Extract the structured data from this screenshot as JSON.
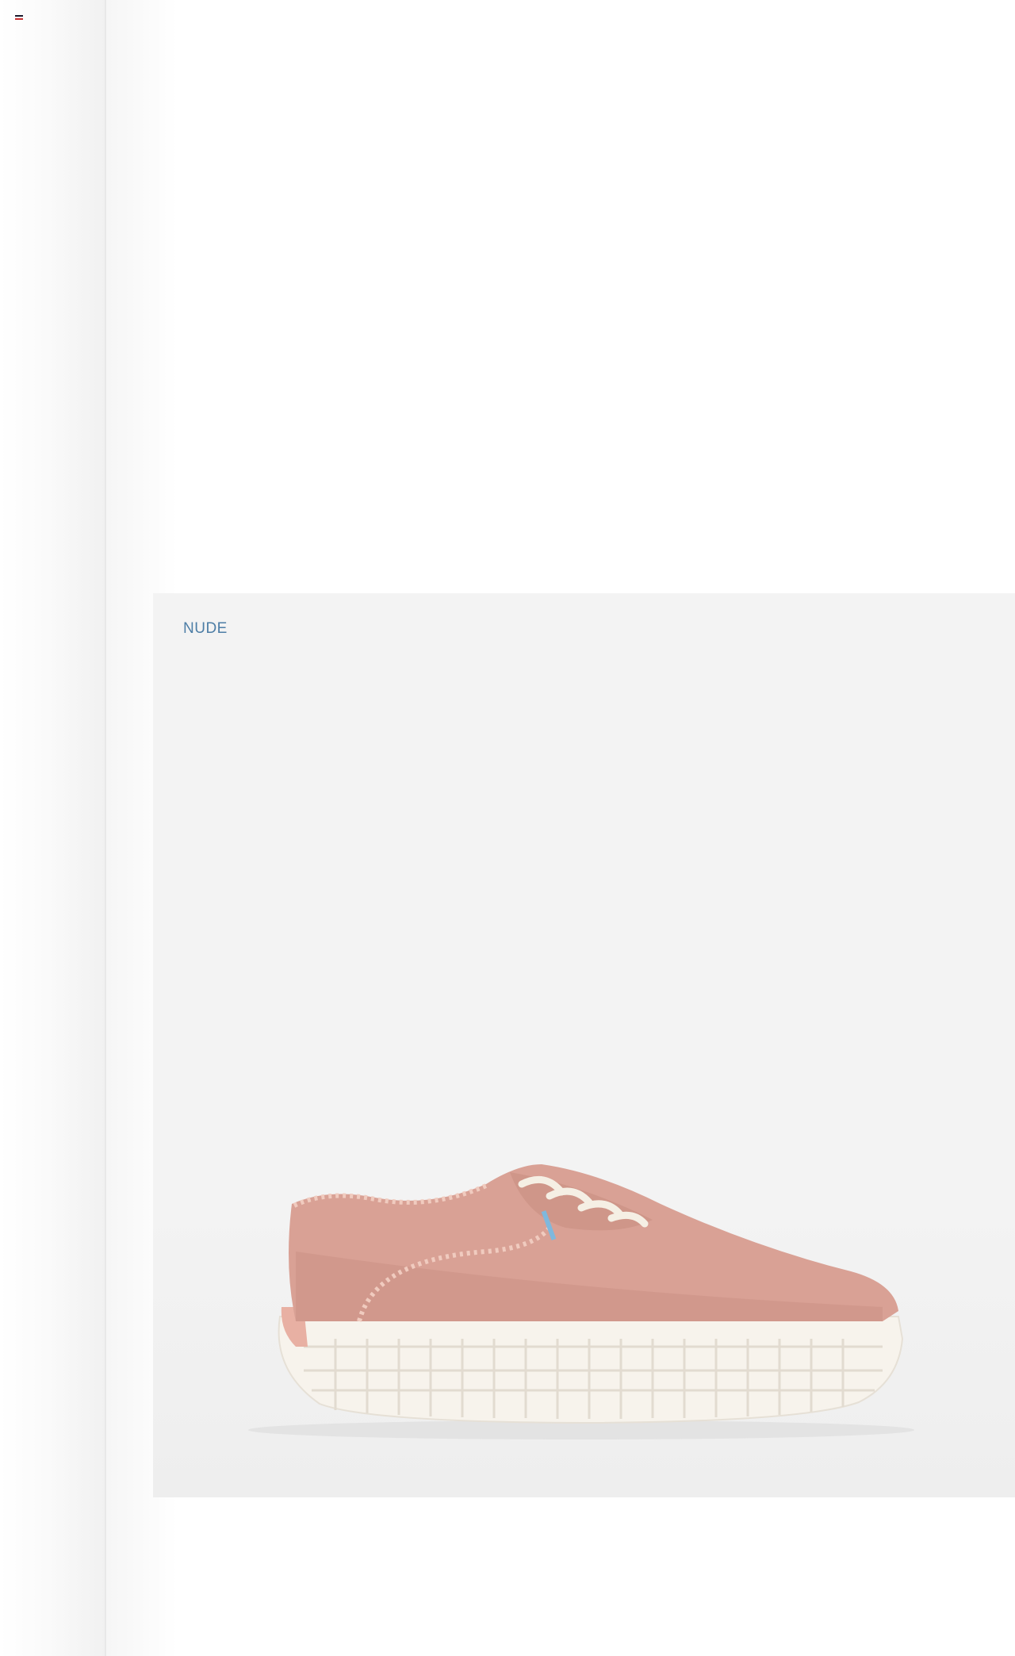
{
  "nav": {
    "menu_icon": "hamburger-menu-icon"
  },
  "product": {
    "color_label": "NUDE",
    "image_icon": "pink-canvas-sneaker-image",
    "colors": {
      "label": "#4d7ea6",
      "upper": "#d9a195",
      "sole": "#f7f3ec",
      "card_bg": "#f3f3f3"
    }
  }
}
